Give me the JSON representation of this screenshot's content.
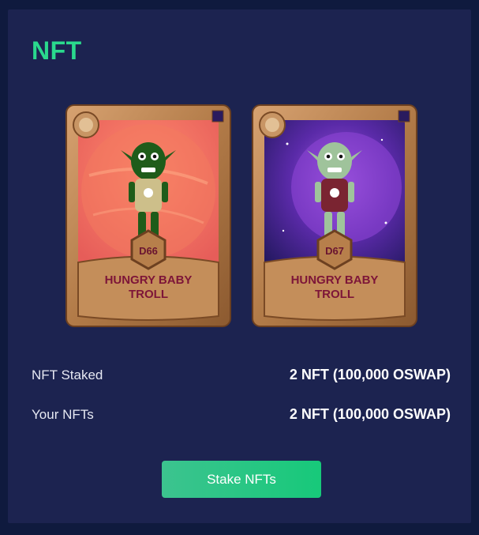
{
  "header": {
    "title": "NFT"
  },
  "nfts": [
    {
      "number": "D66",
      "name": "HUNGRY BABY\nTROLL",
      "background": "red-planet"
    },
    {
      "number": "D67",
      "name": "HUNGRY BABY\nTROLL",
      "background": "purple-space"
    }
  ],
  "stats": {
    "staked_label": "NFT Staked",
    "staked_value": "2 NFT (100,000 OSWAP)",
    "yours_label": "Your NFTs",
    "yours_value": "2 NFT (100,000 OSWAP)"
  },
  "actions": {
    "stake_label": "Stake NFTs"
  },
  "colors": {
    "accent": "#2ad98d",
    "panel": "#1c2350",
    "page": "#0f1a3e",
    "frame": "#b7834f"
  }
}
